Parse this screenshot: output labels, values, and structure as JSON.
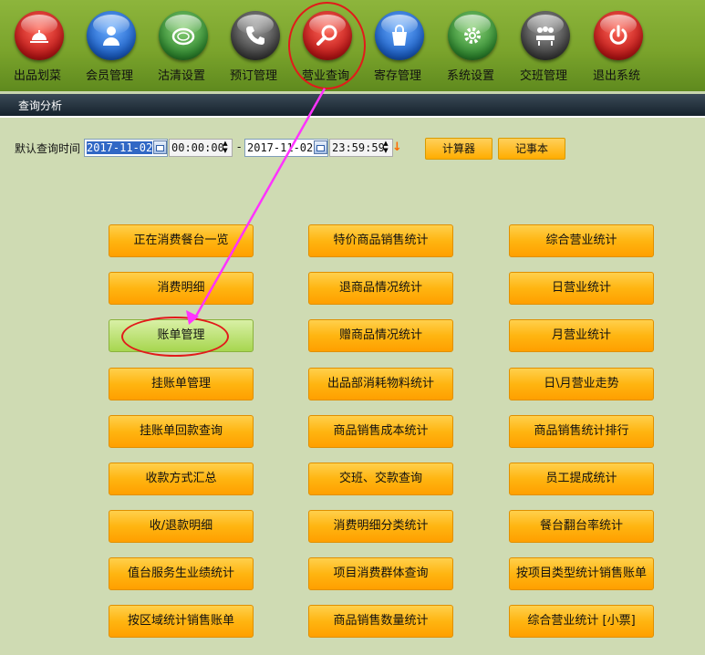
{
  "toolbar": {
    "items": [
      {
        "label": "出品划菜",
        "icon": "cloche-icon",
        "color": "#d82a2a"
      },
      {
        "label": "会员管理",
        "icon": "member-icon",
        "color": "#2a6fcf"
      },
      {
        "label": "沽清设置",
        "icon": "plate-icon",
        "color": "#3c9a3c"
      },
      {
        "label": "预订管理",
        "icon": "phone-icon",
        "color": "#555555"
      },
      {
        "label": "营业查询",
        "icon": "magnifier-icon",
        "color": "#d82a2a"
      },
      {
        "label": "寄存管理",
        "icon": "bag-icon",
        "color": "#2a6fcf"
      },
      {
        "label": "系统设置",
        "icon": "gear-icon",
        "color": "#3c9a3c"
      },
      {
        "label": "交班管理",
        "icon": "meeting-icon",
        "color": "#555555"
      },
      {
        "label": "退出系统",
        "icon": "power-icon",
        "color": "#d82a2a"
      }
    ]
  },
  "section": {
    "title": "查询分析"
  },
  "query": {
    "label": "默认查询时间",
    "start_date": "2017-11-02",
    "start_time": "00:00:00",
    "separator": "-",
    "end_date": "2017-11-02",
    "end_time": "23:59:59",
    "calculator_label": "计算器",
    "notepad_label": "记事本"
  },
  "grid": {
    "col1": [
      "正在消费餐台一览",
      "消费明细",
      "账单管理",
      "挂账单管理",
      "挂账单回款查询",
      "收款方式汇总",
      "收/退款明细",
      "值台服务生业绩统计",
      "按区域统计销售账单"
    ],
    "col2": [
      "特价商品销售统计",
      "退商品情况统计",
      "赠商品情况统计",
      "出品部消耗物料统计",
      "商品销售成本统计",
      "交班、交款查询",
      "消费明细分类统计",
      "项目消费群体查询",
      "商品销售数量统计"
    ],
    "col3": [
      "综合营业统计",
      "日营业统计",
      "月营业统计",
      "日\\月营业走势",
      "商品销售统计排行",
      "员工提成统计",
      "餐台翻台率统计",
      "按项目类型统计销售账单",
      "综合营业统计 [小票]"
    ]
  },
  "colors": {
    "accent_orange": "#ffb511",
    "highlight_red": "#e21a1a",
    "annotation_pink": "#ff33ff",
    "selected_green": "#a7d64f"
  }
}
